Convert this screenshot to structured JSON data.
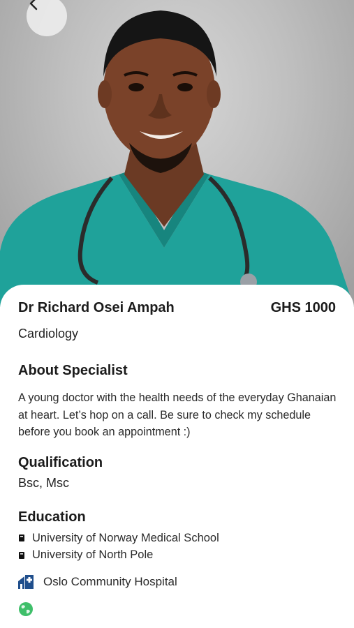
{
  "header": {
    "back_icon": "chevron-left-icon"
  },
  "hero": {
    "photo_alt": "Doctor portrait"
  },
  "doctor": {
    "name": "Dr Richard Osei Ampah",
    "price": "GHS 1000",
    "specialty": "Cardiology"
  },
  "about": {
    "title": "About Specialist",
    "text": "A young doctor with the health needs of the everyday Ghanaian at heart. Let’s hop on a call. Be sure to check my schedule before you book an appointment :)"
  },
  "qualification": {
    "title": "Qualification",
    "value": "Bsc, Msc"
  },
  "education": {
    "title": "Education",
    "items": [
      {
        "label": "University of Norway Medical School"
      },
      {
        "label": "University of North Pole"
      }
    ]
  },
  "hospital": {
    "icon": "hospital-icon",
    "name": "Oslo Community Hospital"
  },
  "website": {
    "icon": "globe-icon"
  },
  "colors": {
    "accent": "#1f4e8c",
    "globe": "#3fbf6a",
    "scrubs": "#1fa29a"
  }
}
